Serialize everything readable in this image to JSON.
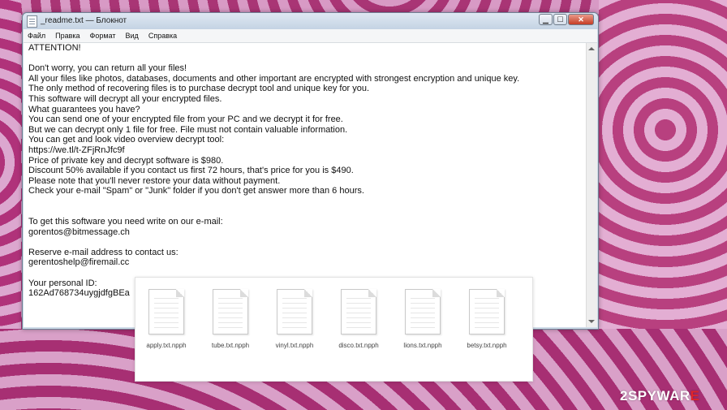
{
  "window": {
    "title": "_readme.txt — Блокнот",
    "buttons": {
      "minimize": "▁",
      "maximize": "☐",
      "close": "✕"
    }
  },
  "menu": {
    "items": [
      "Файл",
      "Правка",
      "Формат",
      "Вид",
      "Справка"
    ]
  },
  "document": {
    "lines": [
      "ATTENTION!",
      "",
      "Don't worry, you can return all your files!",
      "All your files like photos, databases, documents and other important are encrypted with strongest encryption and unique key.",
      "The only method of recovering files is to purchase decrypt tool and unique key for you.",
      "This software will decrypt all your encrypted files.",
      "What guarantees you have?",
      "You can send one of your encrypted file from your PC and we decrypt it for free.",
      "But we can decrypt only 1 file for free. File must not contain valuable information.",
      "You can get and look video overview decrypt tool:",
      "https://we.tl/t-ZFjRnJfc9f",
      "Price of private key and decrypt software is $980.",
      "Discount 50% available if you contact us first 72 hours, that's price for you is $490.",
      "Please note that you'll never restore your data without payment.",
      "Check your e-mail \"Spam\" or \"Junk\" folder if you don't get answer more than 6 hours.",
      "",
      "",
      "To get this software you need write on our e-mail:",
      "gorentos@bitmessage.ch",
      "",
      "Reserve e-mail address to contact us:",
      "gerentoshelp@firemail.cc",
      "",
      "Your personal ID:",
      "162Ad768734uygjdfgBEa"
    ]
  },
  "files": [
    {
      "name": "apply.txt.npph",
      "icon": "document-icon"
    },
    {
      "name": "tube.txt.npph",
      "icon": "document-icon"
    },
    {
      "name": "vinyl.txt.npph",
      "icon": "document-icon"
    },
    {
      "name": "disco.txt.npph",
      "icon": "document-icon"
    },
    {
      "name": "lions.txt.npph",
      "icon": "document-icon"
    },
    {
      "name": "betsy.txt.npph",
      "icon": "document-icon"
    }
  ],
  "watermark": {
    "prefix": "2SPYWAR",
    "suffix": "E"
  },
  "colors": {
    "background": "#b13a7f",
    "watermark_accent": "#e0242b"
  }
}
